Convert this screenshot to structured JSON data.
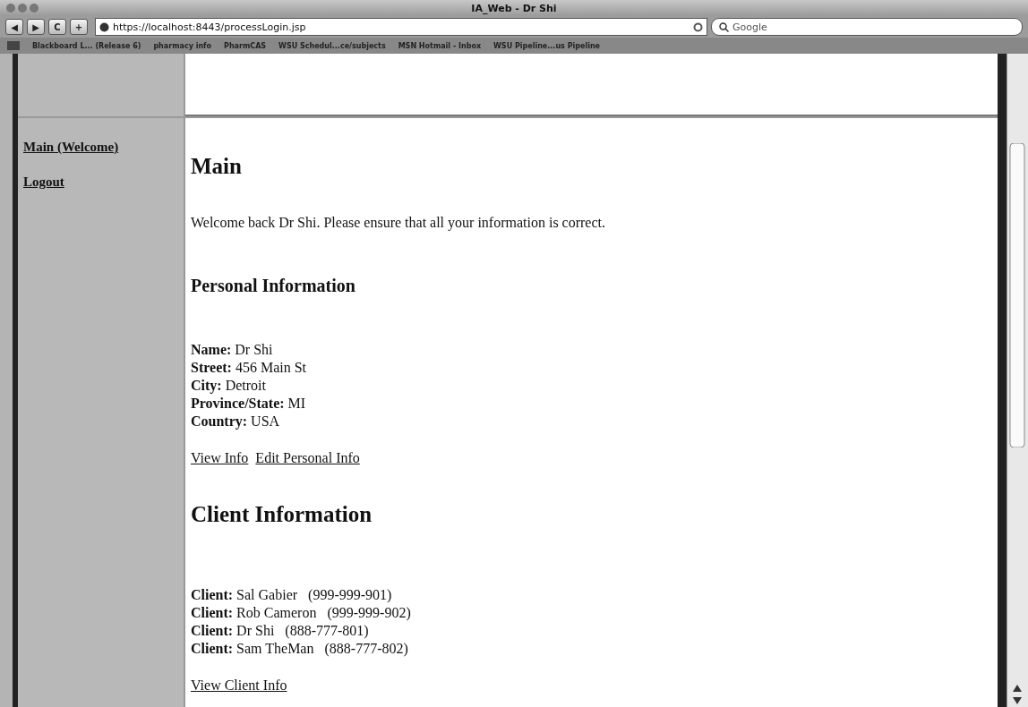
{
  "window": {
    "title": "IA_Web - Dr Shi"
  },
  "toolbar": {
    "back": "◀",
    "forward": "▶",
    "reload": "C",
    "add": "+",
    "url": "https://localhost:8443/processLogin.jsp",
    "search_placeholder": "Google"
  },
  "bookmarks": [
    "Blackboard L... (Release 6)",
    "pharmacy info",
    "PharmCAS",
    "WSU Schedul...ce/subjects",
    "MSN Hotmail - Inbox",
    "WSU Pipeline...us Pipeline"
  ],
  "sidebar": {
    "links": [
      "Main (Welcome)",
      "Logout"
    ]
  },
  "main": {
    "title": "Main",
    "welcome": "Welcome back Dr Shi. Please ensure that all your information is correct.",
    "personal_heading": "Personal Information",
    "personal_fields": [
      {
        "label": "Name:",
        "value": "Dr Shi"
      },
      {
        "label": "Street:",
        "value": "456 Main St"
      },
      {
        "label": "City:",
        "value": "Detroit"
      },
      {
        "label": "Province/State:",
        "value": "MI"
      },
      {
        "label": "Country:",
        "value": "USA"
      }
    ],
    "personal_links": [
      "View Info",
      "Edit Personal Info"
    ],
    "client_heading": "Client Information",
    "clients": [
      {
        "label": "Client:",
        "name": "Sal Gabier",
        "phone": "(999-999-901)"
      },
      {
        "label": "Client:",
        "name": "Rob Cameron",
        "phone": "(999-999-902)"
      },
      {
        "label": "Client:",
        "name": "Dr Shi",
        "phone": "(888-777-801)"
      },
      {
        "label": "Client:",
        "name": "Sam TheMan",
        "phone": "(888-777-802)"
      }
    ],
    "client_links": [
      "View Client Info"
    ]
  }
}
